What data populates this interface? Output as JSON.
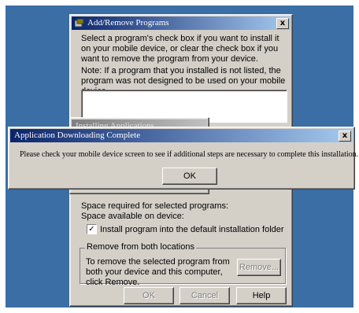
{
  "main_window": {
    "title": "Add/Remove Programs",
    "close_glyph": "x",
    "instructions": "Select a program's check box if you want to install it on your mobile device, or clear the check box if you want to remove the program from your device.",
    "note": "Note:  If a program that you installed is not listed, the program was not designed to be used on your mobile device.",
    "space_required_label": "Space required for selected programs:",
    "space_available_label": "Space available on device:",
    "install_default_label": "Install program into the default installation folder",
    "install_default_checked_glyph": "✓",
    "remove_group_label": "Remove from both locations",
    "remove_description": "To remove the selected program from both your device and this computer, click Remove.",
    "remove_button": "Remove...",
    "ok_button": "OK",
    "cancel_button": "Cancel",
    "help_button": "Help"
  },
  "installing_window": {
    "title": "Installing Applications"
  },
  "alert_dialog": {
    "title": "Application Downloading Complete",
    "close_glyph": "x",
    "message": "Please check your mobile device screen to see if additional steps are necessary to complete this installation.",
    "ok_button": "OK"
  },
  "colors": {
    "desktop": "#3a6ea5",
    "title_active": "#0a246a",
    "face": "#d4d0c8"
  }
}
